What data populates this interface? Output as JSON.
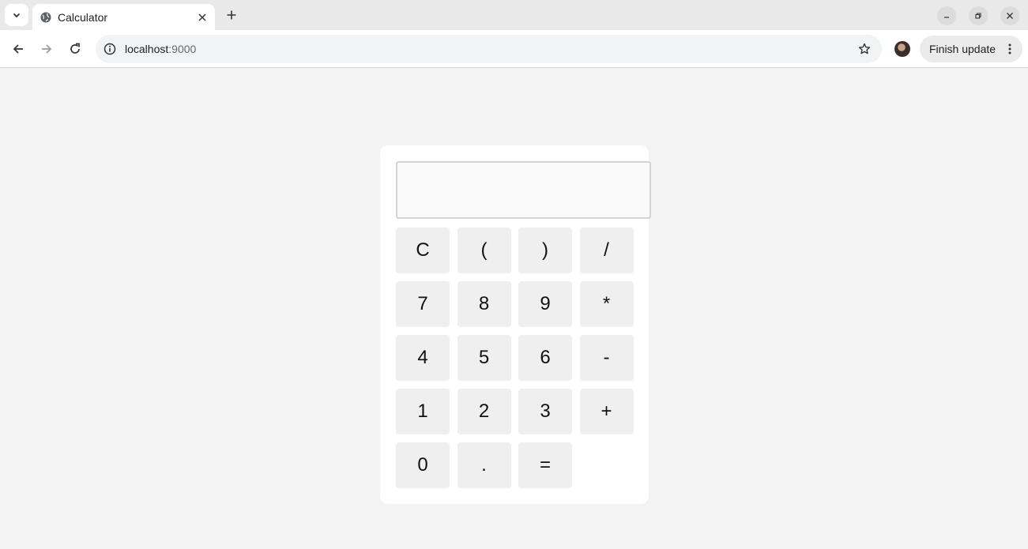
{
  "browser": {
    "tab_title": "Calculator",
    "url_host": "localhost",
    "url_port": ":9000",
    "update_button_label": "Finish update",
    "icons": {
      "tab_search": "chevron-down-icon",
      "favicon": "globe-icon",
      "tab_close": "close-icon",
      "new_tab": "plus-icon",
      "back": "arrow-left-icon",
      "forward": "arrow-right-icon",
      "reload": "reload-icon",
      "site_info": "info-icon",
      "bookmark": "star-icon",
      "menu": "kebab-icon"
    }
  },
  "calculator": {
    "display_value": "",
    "keys": [
      "C",
      "(",
      ")",
      "/",
      "7",
      "8",
      "9",
      "*",
      "4",
      "5",
      "6",
      "-",
      "1",
      "2",
      "3",
      "+",
      "0",
      ".",
      "="
    ]
  },
  "colors": {
    "page_background": "#f3f3f3",
    "calculator_background": "#ffffff",
    "key_background": "#efefef",
    "display_background": "#f9f9f9"
  }
}
